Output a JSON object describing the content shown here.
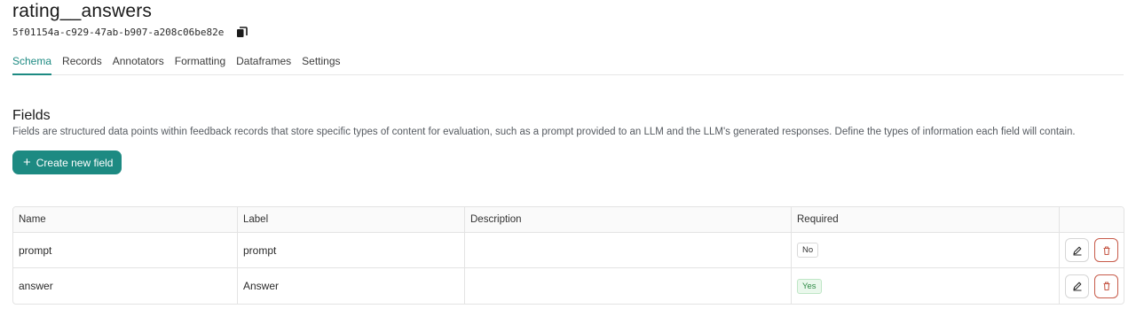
{
  "dataset": {
    "title": "rating__answers",
    "id": "5f01154a-c929-47ab-b907-a208c06be82e"
  },
  "tabs": [
    {
      "label": "Schema",
      "active": true
    },
    {
      "label": "Records",
      "active": false
    },
    {
      "label": "Annotators",
      "active": false
    },
    {
      "label": "Formatting",
      "active": false
    },
    {
      "label": "Dataframes",
      "active": false
    },
    {
      "label": "Settings",
      "active": false
    }
  ],
  "fields_section": {
    "title": "Fields",
    "description": "Fields are structured data points within feedback records that store specific types of content for evaluation, such as a prompt provided to an LLM and the LLM's generated responses. Define the types of information each field will contain.",
    "create_button": "Create new field"
  },
  "table": {
    "headers": [
      "Name",
      "Label",
      "Description",
      "Required",
      ""
    ],
    "rows": [
      {
        "name": "prompt",
        "label": "prompt",
        "description": "",
        "required": "No"
      },
      {
        "name": "answer",
        "label": "Answer",
        "description": "",
        "required": "Yes"
      }
    ]
  },
  "colors": {
    "accent": "#1d8a82",
    "delete": "#c75b4a",
    "required_yes": "#2d8a44"
  },
  "icons": {
    "copy": "copy-icon",
    "plus": "plus-icon",
    "edit": "pencil-icon",
    "delete": "trash-icon"
  }
}
